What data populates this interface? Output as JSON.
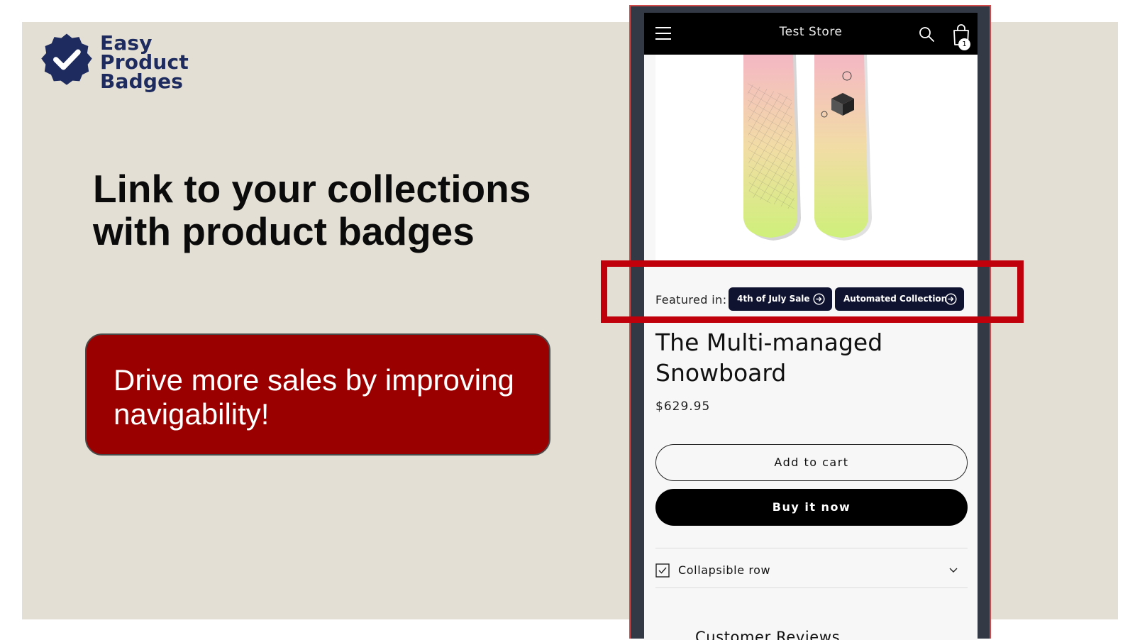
{
  "brand": {
    "logo_lines": [
      "Easy",
      "Product",
      "Badges"
    ],
    "colors": {
      "navy": "#1d2b5e",
      "background": "#e4dfd4",
      "accent_red": "#9b0000"
    }
  },
  "hero": {
    "headline_line1": "Link to your collections",
    "headline_line2": "with product badges"
  },
  "cta": {
    "line1": "Drive more sales by improving",
    "line2": "navigability!"
  },
  "store": {
    "title": "Test Store",
    "cart_count": "1",
    "icons": [
      "hamburger-menu-icon",
      "search-icon",
      "cart-icon"
    ],
    "featured_label": "Featured in:",
    "badges": [
      {
        "label": "4th of July Sale",
        "icon": "arrow-circle-right-icon"
      },
      {
        "label": "Automated Collection",
        "icon": "arrow-circle-right-icon"
      }
    ],
    "product": {
      "title_line1": "The Multi-managed",
      "title_line2": "Snowboard",
      "price": "$629.95"
    },
    "add_to_cart_label": "Add to cart",
    "buy_now_label": "Buy it now",
    "collapsible_label": "Collapsible row",
    "reviews_heading": "Customer Reviews"
  }
}
